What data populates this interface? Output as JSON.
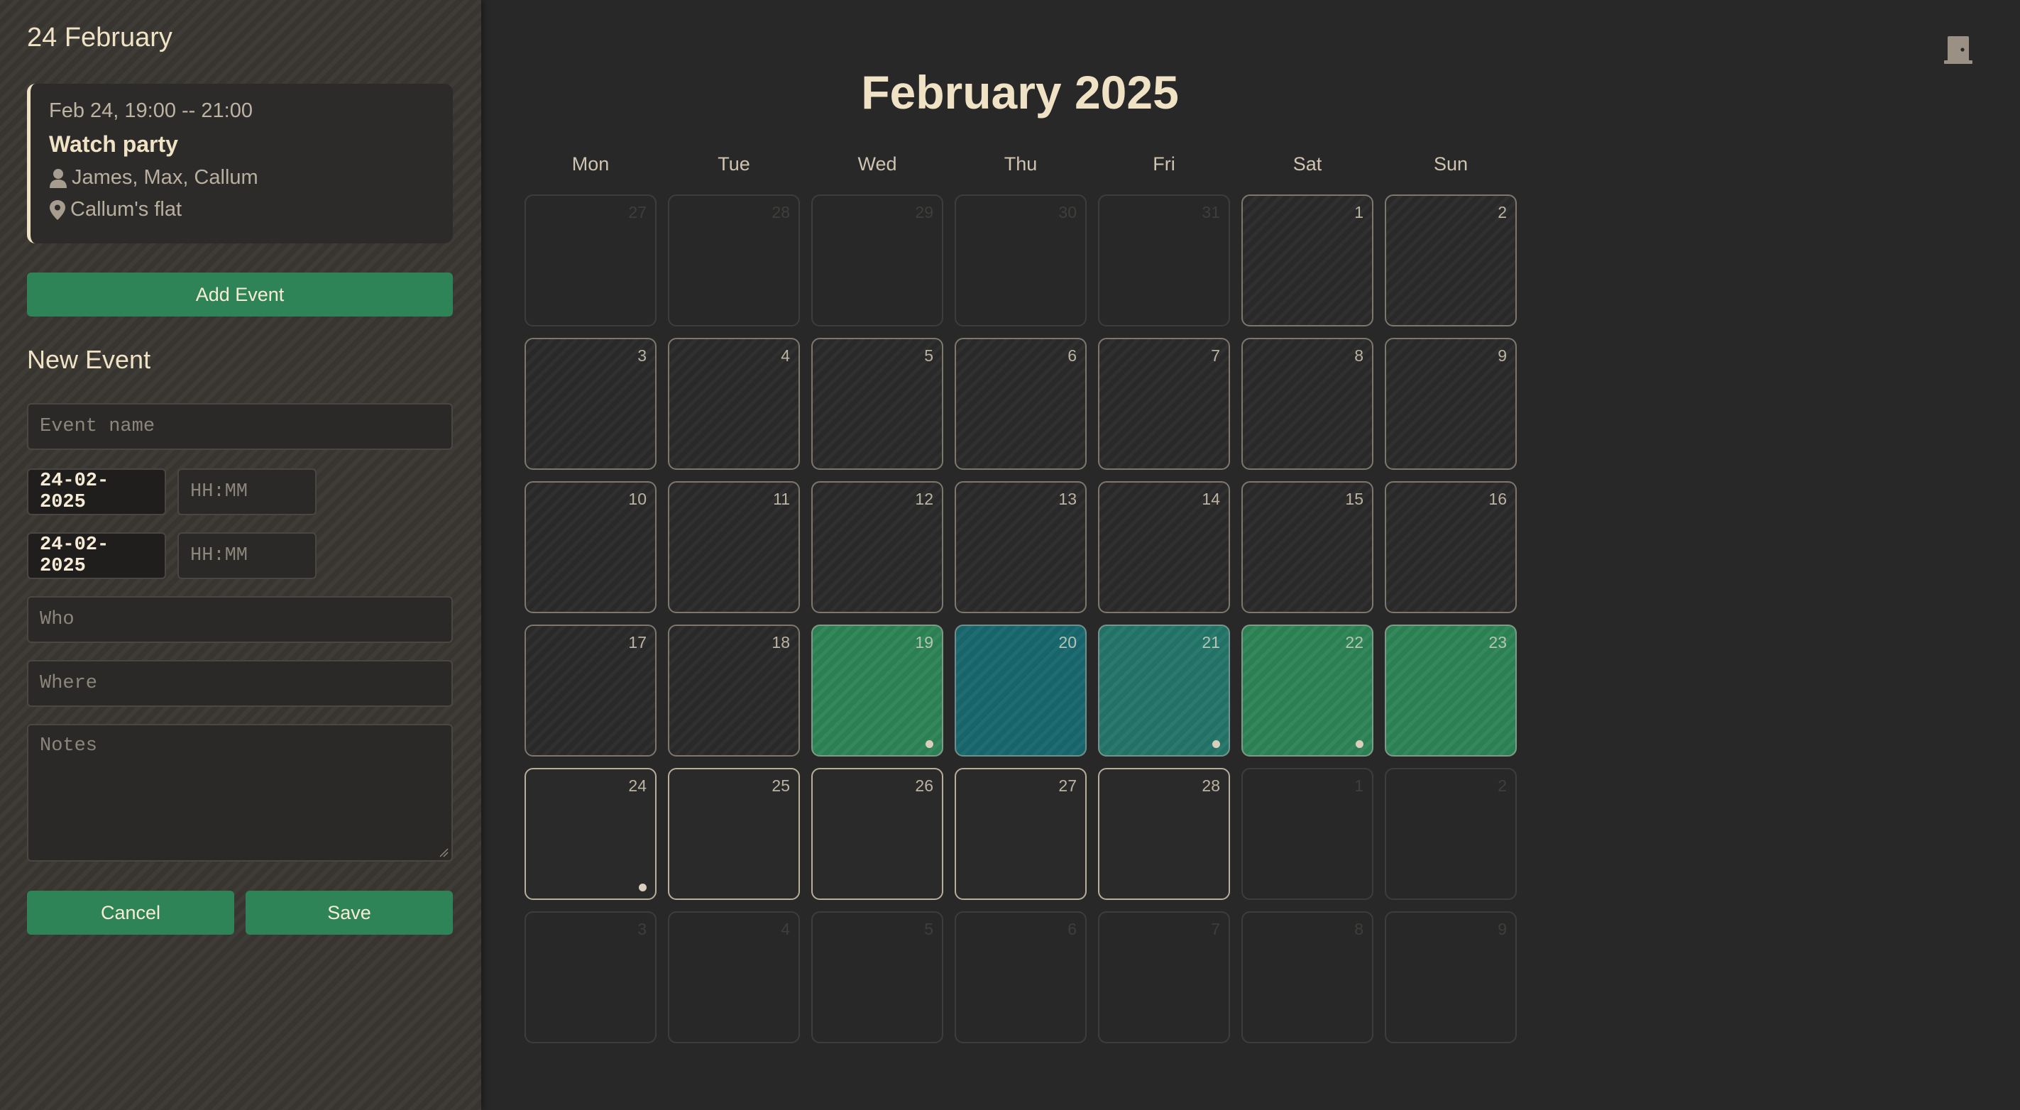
{
  "sidebar": {
    "day_heading": "24 February",
    "event": {
      "time": "Feb 24, 19:00 -- 21:00",
      "title": "Watch party",
      "who": "James, Max, Callum",
      "where": "Callum's flat"
    },
    "add_event_label": "Add Event",
    "new_event_heading": "New Event",
    "form": {
      "name_placeholder": "Event name",
      "start_date": "24-02-2025",
      "start_time_placeholder": "HH:MM",
      "end_date": "24-02-2025",
      "end_time_placeholder": "HH:MM",
      "who_placeholder": "Who",
      "where_placeholder": "Where",
      "notes_placeholder": "Notes"
    },
    "cancel_label": "Cancel",
    "save_label": "Save"
  },
  "calendar": {
    "month_title": "February 2025",
    "weekdays": [
      "Mon",
      "Tue",
      "Wed",
      "Thu",
      "Fri",
      "Sat",
      "Sun"
    ],
    "days": [
      {
        "n": "27",
        "style": "other",
        "dot": false
      },
      {
        "n": "28",
        "style": "other",
        "dot": false
      },
      {
        "n": "29",
        "style": "other",
        "dot": false
      },
      {
        "n": "30",
        "style": "other",
        "dot": false
      },
      {
        "n": "31",
        "style": "other",
        "dot": false
      },
      {
        "n": "1",
        "style": "hatched",
        "dot": false
      },
      {
        "n": "2",
        "style": "hatched",
        "dot": false
      },
      {
        "n": "3",
        "style": "hatched",
        "dot": false
      },
      {
        "n": "4",
        "style": "hatched",
        "dot": false
      },
      {
        "n": "5",
        "style": "hatched",
        "dot": false
      },
      {
        "n": "6",
        "style": "hatched",
        "dot": false
      },
      {
        "n": "7",
        "style": "hatched",
        "dot": false
      },
      {
        "n": "8",
        "style": "hatched",
        "dot": false
      },
      {
        "n": "9",
        "style": "hatched",
        "dot": false
      },
      {
        "n": "10",
        "style": "hatched",
        "dot": false
      },
      {
        "n": "11",
        "style": "hatched",
        "dot": false
      },
      {
        "n": "12",
        "style": "hatched",
        "dot": false
      },
      {
        "n": "13",
        "style": "hatched",
        "dot": false
      },
      {
        "n": "14",
        "style": "hatched",
        "dot": false
      },
      {
        "n": "15",
        "style": "hatched",
        "dot": false
      },
      {
        "n": "16",
        "style": "hatched",
        "dot": false
      },
      {
        "n": "17",
        "style": "hatched",
        "dot": false
      },
      {
        "n": "18",
        "style": "hatched",
        "dot": false
      },
      {
        "n": "19",
        "style": "green",
        "dot": true
      },
      {
        "n": "20",
        "style": "teal",
        "dot": false
      },
      {
        "n": "21",
        "style": "blend",
        "dot": true
      },
      {
        "n": "22",
        "style": "green",
        "dot": true
      },
      {
        "n": "23",
        "style": "green",
        "dot": false
      },
      {
        "n": "24",
        "style": "current",
        "dot": true
      },
      {
        "n": "25",
        "style": "current",
        "dot": false
      },
      {
        "n": "26",
        "style": "current",
        "dot": false
      },
      {
        "n": "27",
        "style": "current",
        "dot": false
      },
      {
        "n": "28",
        "style": "current",
        "dot": false
      },
      {
        "n": "1",
        "style": "other",
        "dot": false
      },
      {
        "n": "2",
        "style": "other",
        "dot": false
      },
      {
        "n": "3",
        "style": "other",
        "dot": false
      },
      {
        "n": "4",
        "style": "other",
        "dot": false
      },
      {
        "n": "5",
        "style": "other",
        "dot": false
      },
      {
        "n": "6",
        "style": "other",
        "dot": false
      },
      {
        "n": "7",
        "style": "other",
        "dot": false
      },
      {
        "n": "8",
        "style": "other",
        "dot": false
      },
      {
        "n": "9",
        "style": "other",
        "dot": false
      }
    ]
  },
  "icons": {
    "exit": "door-icon",
    "person": "person-icon",
    "location": "location-pin-icon"
  },
  "colors": {
    "accent_green": "#2e8456",
    "accent_teal": "#18686e",
    "text_cream": "#f0e2c4"
  }
}
